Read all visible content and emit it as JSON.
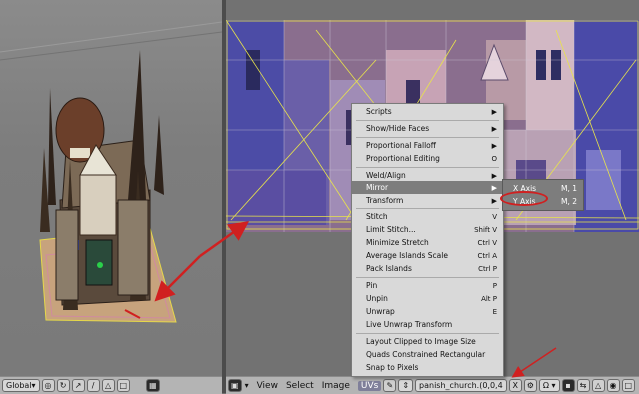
{
  "left_footer": {
    "orientation": "Global"
  },
  "right_footer": {
    "menus": [
      "View",
      "Select",
      "Image",
      "UVs"
    ],
    "image_name": "panish_church.(0,0,4",
    "close_label": "X"
  },
  "uvs_menu": {
    "items": [
      {
        "label": "Scripts",
        "shortcut": "",
        "submenu": true
      },
      {
        "label": "Show/Hide Faces",
        "shortcut": "",
        "submenu": true
      },
      {
        "label": "Proportional Falloff",
        "shortcut": "",
        "submenu": true
      },
      {
        "label": "Proportional Editing",
        "shortcut": "O",
        "submenu": false
      },
      {
        "label": "Weld/Align",
        "shortcut": "",
        "submenu": true
      },
      {
        "label": "Mirror",
        "shortcut": "",
        "submenu": true
      },
      {
        "label": "Transform",
        "shortcut": "",
        "submenu": true
      },
      {
        "label": "Stitch",
        "shortcut": "V",
        "submenu": false
      },
      {
        "label": "Limit Stitch...",
        "shortcut": "Shift V",
        "submenu": false
      },
      {
        "label": "Minimize Stretch",
        "shortcut": "Ctrl V",
        "submenu": false
      },
      {
        "label": "Average Islands Scale",
        "shortcut": "Ctrl A",
        "submenu": false
      },
      {
        "label": "Pack Islands",
        "shortcut": "Ctrl P",
        "submenu": false
      },
      {
        "label": "Pin",
        "shortcut": "P",
        "submenu": false
      },
      {
        "label": "Unpin",
        "shortcut": "Alt P",
        "submenu": false
      },
      {
        "label": "Unwrap",
        "shortcut": "E",
        "submenu": false
      },
      {
        "label": "Live Unwrap Transform",
        "shortcut": "",
        "submenu": false
      },
      {
        "label": "Layout Clipped to Image Size",
        "shortcut": "",
        "submenu": false
      },
      {
        "label": "Quads Constrained Rectangular",
        "shortcut": "",
        "submenu": false
      },
      {
        "label": "Snap to Pixels",
        "shortcut": "",
        "submenu": false
      }
    ]
  },
  "mirror_submenu": {
    "items": [
      {
        "label": "X Axis",
        "shortcut": "M, 1"
      },
      {
        "label": "Y Axis",
        "shortcut": "M, 2"
      }
    ]
  },
  "colors": {
    "menu_bg": "#d9d9d9",
    "highlight": "#7d7d7d",
    "annotation_red": "#d02020",
    "uv_wire": "#e8e44a"
  }
}
